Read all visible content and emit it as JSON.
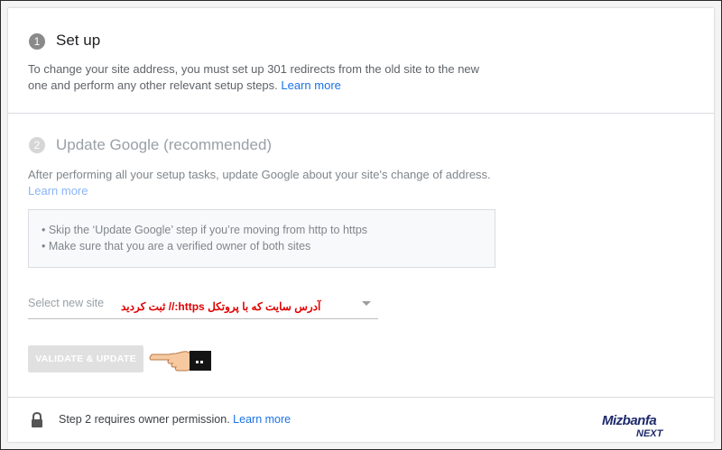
{
  "step1": {
    "number": "1",
    "title": "Set up",
    "desc_line1": "To change your site address, you must set up 301 redirects from the old site to the new",
    "desc_line2": "one and perform any other relevant setup steps.",
    "learn_more": "Learn more"
  },
  "step2": {
    "number": "2",
    "title": "Update Google (recommended)",
    "desc_line1": "After performing all your setup tasks, update Google about your site's change of address.",
    "learn_more": "Learn more",
    "tips": [
      "• Skip the ‘Update Google’ step if you’re moving from http to https",
      "• Make sure that you are a verified owner of both sites"
    ],
    "select_placeholder": "Select new site",
    "overlay_note": "آدرس سایت که با پروتکل https:// ثبت کردید",
    "validate_button": "VALIDATE & UPDATE"
  },
  "footer": {
    "text": "Step 2 requires owner permission.",
    "learn_more": "Learn more"
  },
  "brand": {
    "name": "Mizbanfa",
    "tag": "NEXT"
  },
  "colors": {
    "link": "#1a73e8",
    "annotation": "#e00000",
    "disabled_button": "#e0e0e0",
    "step_circle_active": "#8a8a8a",
    "step_circle_inactive": "#d6d6d6"
  }
}
